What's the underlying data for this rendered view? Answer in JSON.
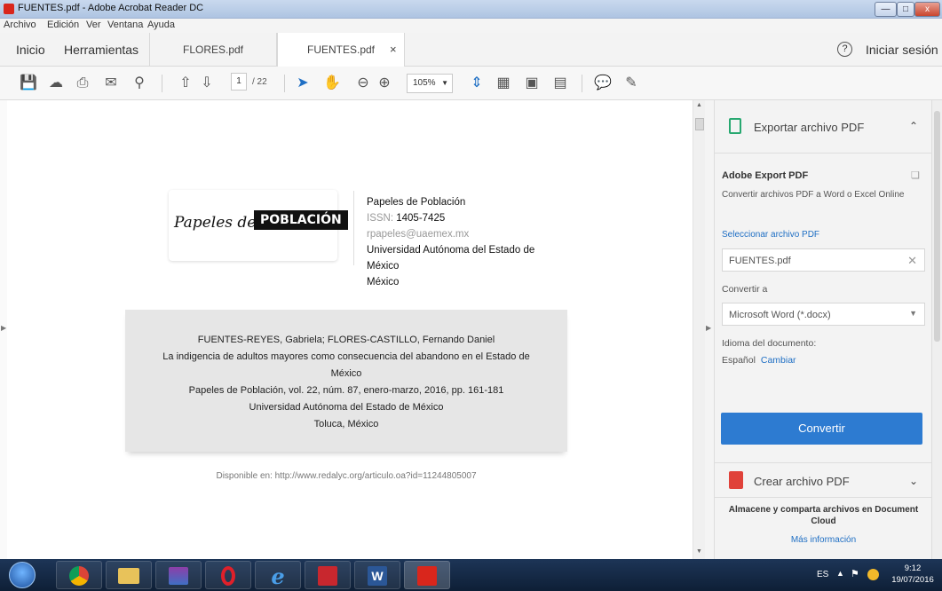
{
  "window": {
    "title": "FUENTES.pdf - Adobe Acrobat Reader DC"
  },
  "menu": [
    "Archivo",
    "Edición",
    "Ver",
    "Ventana",
    "Ayuda"
  ],
  "tabs": {
    "home": "Inicio",
    "tools": "Herramientas",
    "doc1": "FLORES.pdf",
    "doc2": "FUENTES.pdf",
    "close": "×",
    "help": "?",
    "signin": "Iniciar sesión"
  },
  "toolbar": {
    "page_current": "1",
    "page_total": "/ 22",
    "zoom": "105%"
  },
  "document": {
    "logo_script": "Papeles de",
    "logo_box": "POBLACIÓN",
    "journal_title": "Papeles de Población",
    "issn_label": "ISSN:",
    "issn_value": "1405-7425",
    "email": "rpapeles@uaemex.mx",
    "institution_l1": "Universidad Autónoma del Estado de",
    "institution_l2": "México",
    "country": "México",
    "citation": {
      "authors": "FUENTES-REYES, Gabriela; FLORES-CASTILLO, Fernando Daniel",
      "title_l1": "La indigencia de adultos mayores como consecuencia del abandono en el Estado de",
      "title_l2": "México",
      "journal": "Papeles de Población, vol. 22, núm. 87, enero-marzo, 2016, pp. 161-181",
      "institution": "Universidad Autónoma del Estado de México",
      "place": "Toluca, México"
    },
    "available": "Disponible en: http://www.redalyc.org/articulo.oa?id=11244805007"
  },
  "panel": {
    "export_header": "Exportar archivo PDF",
    "section_title": "Adobe Export PDF",
    "section_desc": "Convertir archivos PDF a Word o Excel Online",
    "select_link": "Seleccionar archivo PDF",
    "file_value": "FUENTES.pdf",
    "convert_to_label": "Convertir a",
    "format_value": "Microsoft Word (*.docx)",
    "lang_label": "Idioma del documento:",
    "lang_value": "Español",
    "lang_change": "Cambiar",
    "convert_button": "Convertir",
    "create_header": "Crear archivo PDF",
    "cloud_text_l1": "Almacene y comparta archivos en Document",
    "cloud_text_l2": "Cloud",
    "more_info": "Más información"
  },
  "taskbar": {
    "lang": "ES",
    "time": "9:12",
    "date": "19/07/2016"
  },
  "colors": {
    "accent": "#2d7bd1",
    "pdf_red": "#d9261c",
    "export_green": "#27a870"
  }
}
